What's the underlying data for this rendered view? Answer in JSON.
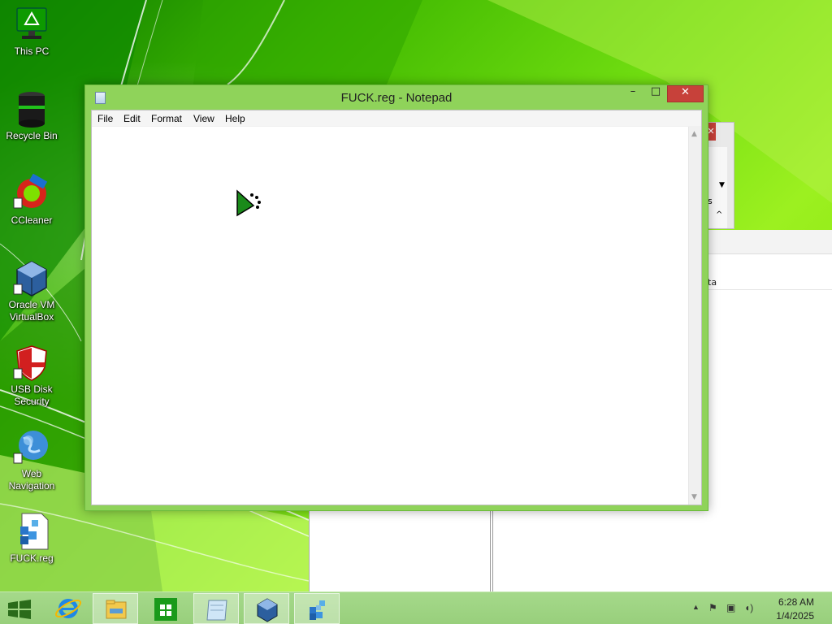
{
  "desktop": {
    "icons": [
      {
        "label": "This PC",
        "icon": "monitor-icon"
      },
      {
        "label": "Recycle Bin",
        "icon": "recycle-bin-icon"
      },
      {
        "label": "CCleaner",
        "icon": "ccleaner-icon"
      },
      {
        "label": "Oracle VM VirtualBox",
        "icon": "virtualbox-icon"
      },
      {
        "label": "USB Disk Security",
        "icon": "shield-icon"
      },
      {
        "label": "Web Navigation",
        "icon": "globe-icon"
      },
      {
        "label": "FUCK.reg",
        "icon": "registry-file-icon"
      }
    ]
  },
  "background_window": {
    "partial_text_1": "s",
    "partial_text_2": "ta"
  },
  "notepad": {
    "title": "FUCK.reg - Notepad",
    "menu": [
      "File",
      "Edit",
      "Format",
      "View",
      "Help"
    ],
    "content": "",
    "close_glyph": "✕",
    "minimize_glyph": "–",
    "maximize_glyph": "□"
  },
  "taskbar": {
    "buttons": [
      {
        "icon": "start-windows-icon"
      },
      {
        "icon": "internet-explorer-icon"
      },
      {
        "icon": "file-explorer-icon"
      },
      {
        "icon": "store-icon"
      },
      {
        "icon": "notepad-icon",
        "active": true
      },
      {
        "icon": "virtualbox-icon"
      },
      {
        "icon": "registry-editor-icon"
      }
    ],
    "clock": {
      "time": "6:28 AM",
      "date": "1/4/2025"
    },
    "tray_icons": [
      "chevron-up-icon",
      "flag-icon",
      "network-icon",
      "volume-icon"
    ]
  },
  "colors": {
    "window_frame": "#8fd35a",
    "close_button": "#c7413a",
    "taskbar": "#9fd483"
  }
}
